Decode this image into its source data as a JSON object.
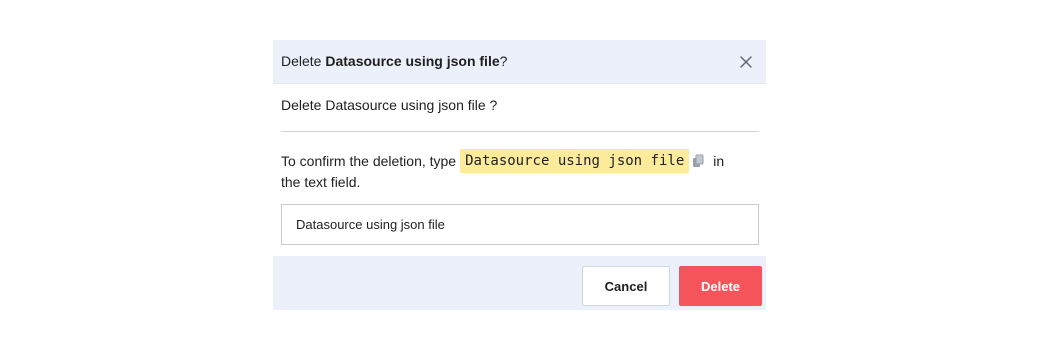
{
  "dialog": {
    "title_prefix": "Delete ",
    "title_name": "Datasource using json file",
    "title_suffix": "?",
    "subtitle": "Delete Datasource using json file ?",
    "confirm_before": "To confirm the deletion, type",
    "confirm_code": "Datasource using json file",
    "confirm_after": "in",
    "confirm_line2": "the text field.",
    "input_value": "Datasource using json file",
    "cancel_label": "Cancel",
    "delete_label": "Delete"
  },
  "icons": {
    "close": "close-icon",
    "copy": "copy-icon"
  },
  "colors": {
    "header_bg": "#ebf0fb",
    "code_highlight": "#fceb9b",
    "delete_button": "#f5555a"
  }
}
